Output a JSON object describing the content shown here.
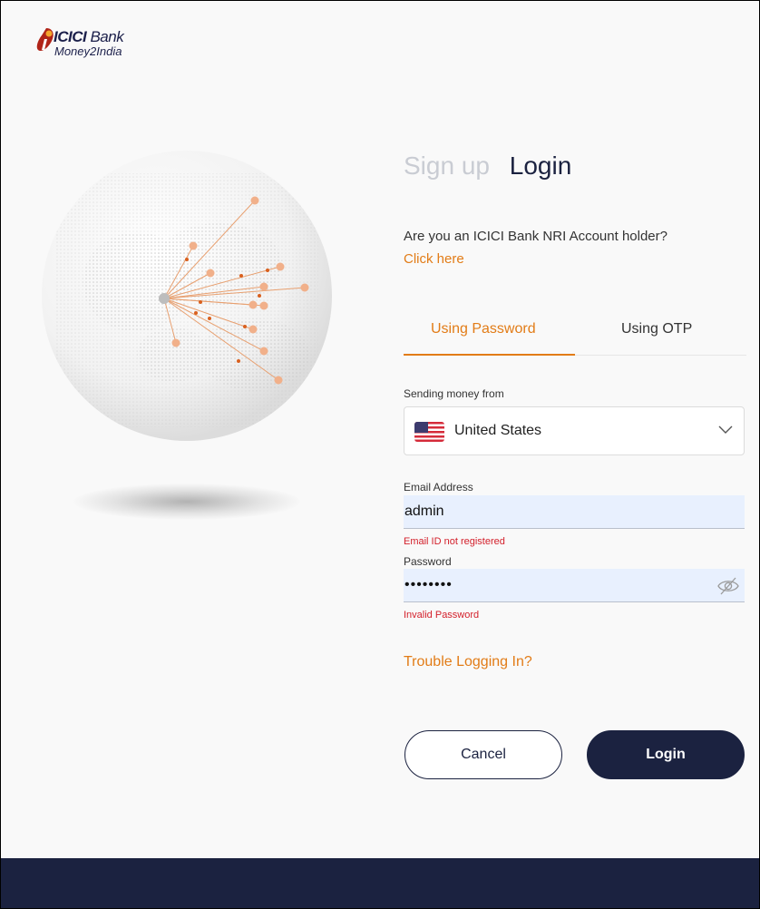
{
  "brand": {
    "name": "ICICI",
    "name_suffix": "Bank",
    "product": "Money2India",
    "primary_color": "#1b2240",
    "accent_color": "#e27c17",
    "error_color": "#d3202b"
  },
  "auth_tabs": {
    "signup": "Sign up",
    "login": "Login",
    "active": "login"
  },
  "nri": {
    "question": "Are you an ICICI Bank NRI Account holder?",
    "link": "Click here"
  },
  "login_method": {
    "tabs": [
      "Using Password",
      "Using OTP"
    ],
    "active": "Using Password"
  },
  "form": {
    "country_label": "Sending money from",
    "country_value": "United States",
    "country_flag": "us-flag-icon",
    "email_label": "Email Address",
    "email_value": "admin",
    "email_error": "Email ID not registered",
    "password_label": "Password",
    "password_value": "••••••••",
    "password_error": "Invalid Password"
  },
  "trouble_link": "Trouble Logging In?",
  "buttons": {
    "cancel": "Cancel",
    "login": "Login"
  }
}
